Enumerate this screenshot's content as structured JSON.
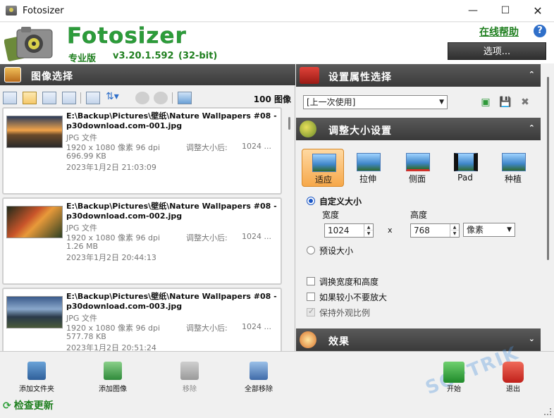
{
  "window": {
    "title": "Fotosizer"
  },
  "header": {
    "logo_text": "Fotosizer",
    "edition": "专业版",
    "version": "v3.20.1.592",
    "bits": "(32-bit)",
    "online_help": "在线帮助",
    "options_label": "选项..."
  },
  "image_panel": {
    "title": "图像选择",
    "image_count": "100 图像",
    "items": [
      {
        "filename": "E:\\Backup\\Pictures\\壁纸\\Nature Wallpapers #08 - p30download.com-001.jpg",
        "type": "JPG 文件",
        "dimensions": "1920 x 1080 像素  96 dpi",
        "size": "696.99 KB",
        "date": "2023年1月2日 21:03:09",
        "resize_label": "调整大小后:",
        "resize_value": "1024 ..."
      },
      {
        "filename": "E:\\Backup\\Pictures\\壁纸\\Nature Wallpapers #08 - p30download.com-002.jpg",
        "type": "JPG 文件",
        "dimensions": "1920 x 1080 像素  96 dpi",
        "size": "1.26 MB",
        "date": "2023年1月2日 20:44:13",
        "resize_label": "调整大小后:",
        "resize_value": "1024 ..."
      },
      {
        "filename": "E:\\Backup\\Pictures\\壁纸\\Nature Wallpapers #08 - p30download.com-003.jpg",
        "type": "JPG 文件",
        "dimensions": "1920 x 1080 像素  96 dpi",
        "size": "577.78 KB",
        "date": "2023年1月2日 20:51:24",
        "resize_label": "调整大小后:",
        "resize_value": "1024 ..."
      }
    ]
  },
  "settings_panel": {
    "profile_title": "设置属性选择",
    "preset_value": "[上一次使用]",
    "resize_title": "调整大小设置",
    "modes": [
      {
        "label": "适应",
        "selected": true
      },
      {
        "label": "拉伸",
        "selected": false
      },
      {
        "label": "侧面",
        "selected": false
      },
      {
        "label": "Pad",
        "selected": false
      },
      {
        "label": "种植",
        "selected": false
      }
    ],
    "custom_size_label": "自定义大小",
    "width_label": "宽度",
    "height_label": "高度",
    "width_value": "1024",
    "height_value": "768",
    "times": "x",
    "unit_value": "像素",
    "preset_size_label": "预设大小",
    "swap_label": "调换宽度和高度",
    "no_enlarge_label": "如果较小不要放大",
    "keep_aspect_label": "保持外观比例",
    "effects_title": "效果"
  },
  "bottom": {
    "add_folder": "添加文件夹",
    "add_images": "添加图像",
    "remove": "移除",
    "remove_all": "全部移除",
    "start": "开始",
    "exit": "退出",
    "check_updates": "检查更新"
  }
}
